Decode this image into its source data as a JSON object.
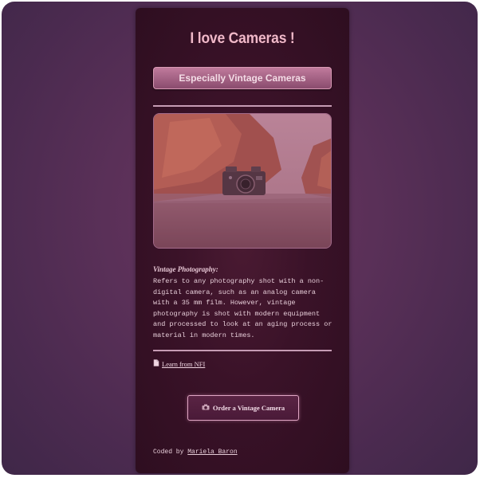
{
  "page": {
    "title": "I love Cameras !",
    "subtitle_button": "Especially Vintage Cameras"
  },
  "article": {
    "heading": "Vintage Photography:",
    "text": "Refers to any photography shot with a non-digital camera, such as an analog camera with a 35 mm film. However, vintage photography is shot with modern equipment and processed to look at an aging process or material in modern times."
  },
  "links": {
    "learn_more": "Learn from NFI"
  },
  "order_button": {
    "label": "Order a Vintage Camera"
  },
  "footer": {
    "prefix": "Coded by",
    "author": "Mariela Baron"
  },
  "icons": {
    "learn_icon": "document-icon",
    "order_icon": "camera-icon"
  },
  "colors": {
    "background": "#4a2a4f",
    "card": "#3a1228",
    "accent": "#c07a9c",
    "title": "#f0b8c8"
  }
}
